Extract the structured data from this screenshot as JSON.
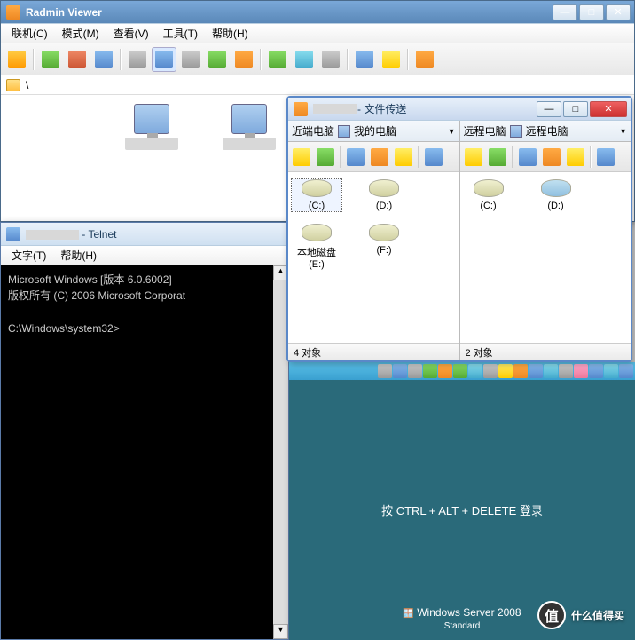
{
  "radmin": {
    "title": "Radmin Viewer",
    "menus": [
      "联机(C)",
      "模式(M)",
      "查看(V)",
      "工具(T)",
      "帮助(H)"
    ],
    "path": "\\"
  },
  "telnet": {
    "title_suffix": " - Telnet",
    "menus": [
      "文字(T)",
      "帮助(H)"
    ],
    "line1": "Microsoft Windows [版本 6.0.6002]",
    "line2": "版权所有 (C) 2006 Microsoft Corporat",
    "prompt": "C:\\Windows\\system32>"
  },
  "ft": {
    "title": " - 文件传送",
    "left": {
      "header": "近端电脑",
      "loc": "我的电脑",
      "drives": [
        {
          "label": "(C:)",
          "sel": true
        },
        {
          "label": "(D:)"
        },
        {
          "label": "本地磁盘 (E:)"
        },
        {
          "label": "(F:)"
        }
      ],
      "status": "4 对象"
    },
    "right": {
      "header": "远程电脑",
      "loc": "远程电脑",
      "drives": [
        {
          "label": "(C:)"
        },
        {
          "label": "(D:)",
          "cd": true
        }
      ],
      "status": "2 对象"
    }
  },
  "remote": {
    "prompt": "按 CTRL + ALT + DELETE 登录",
    "branding": "Windows Server 2008",
    "edition": "Standard"
  },
  "watermark": "什么值得买"
}
